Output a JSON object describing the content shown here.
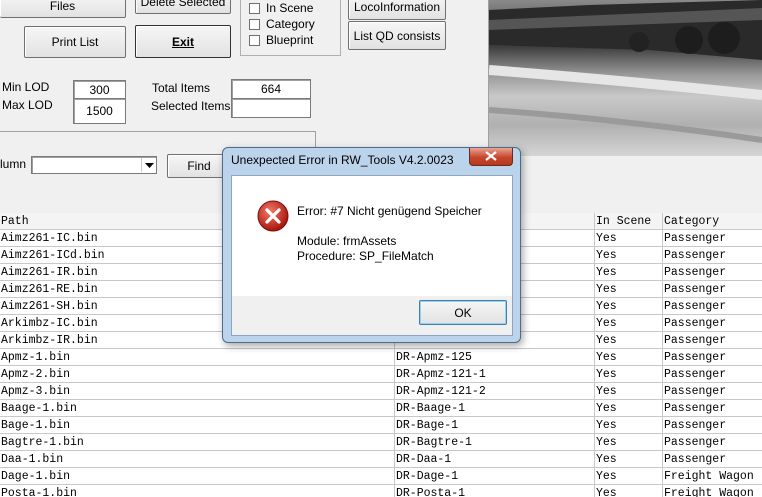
{
  "toolbar": {
    "files_label": "Files",
    "delete_selected_label": "Delete Selected",
    "print_list_label": "Print List",
    "exit_label": "Exit",
    "loco_info_label": "LocoInformation",
    "list_qd_label": "List QD consists"
  },
  "filters": {
    "in_scene": "In Scene",
    "category": "Category",
    "blueprint": "Blueprint"
  },
  "lod": {
    "min_label": "Min LOD",
    "min_value": "300",
    "max_label": "Max LOD",
    "max_value": "1500"
  },
  "totals": {
    "total_label": "Total Items",
    "total_value": "664",
    "selected_label": "Selected Items:",
    "selected_value": ""
  },
  "search": {
    "column_label": "lumn",
    "find_label": "Find"
  },
  "grid": {
    "headers": [
      "Path",
      "",
      "In Scene",
      "Category"
    ],
    "rows": [
      [
        "Aimz261-IC.bin",
        "",
        "Yes",
        "Passenger"
      ],
      [
        "Aimz261-ICd.bin",
        "",
        "Yes",
        "Passenger"
      ],
      [
        "Aimz261-IR.bin",
        "",
        "Yes",
        "Passenger"
      ],
      [
        "Aimz261-RE.bin",
        "",
        "Yes",
        "Passenger"
      ],
      [
        "Aimz261-SH.bin",
        "",
        "Yes",
        "Passenger"
      ],
      [
        "Arkimbz-IC.bin",
        "",
        "Yes",
        "Passenger"
      ],
      [
        "Arkimbz-IR.bin",
        "",
        "Yes",
        "Passenger"
      ],
      [
        "Apmz-1.bin",
        "DR-Apmz-125",
        "Yes",
        "Passenger"
      ],
      [
        "Apmz-2.bin",
        "DR-Apmz-121-1",
        "Yes",
        "Passenger"
      ],
      [
        "Apmz-3.bin",
        "DR-Apmz-121-2",
        "Yes",
        "Passenger"
      ],
      [
        "Baage-1.bin",
        "DR-Baage-1",
        "Yes",
        "Passenger"
      ],
      [
        "Bage-1.bin",
        "DR-Bage-1",
        "Yes",
        "Passenger"
      ],
      [
        "Bagtre-1.bin",
        "DR-Bagtre-1",
        "Yes",
        "Passenger"
      ],
      [
        "Daa-1.bin",
        "DR-Daa-1",
        "Yes",
        "Passenger"
      ],
      [
        "Dage-1.bin",
        "DR-Dage-1",
        "Yes",
        "Freight Wagon"
      ],
      [
        "Posta-1.bin",
        "DR-Posta-1",
        "Yes",
        "Freight Wagon"
      ]
    ]
  },
  "dialog": {
    "title": "Unexpected Error in RW_Tools V4.2.0023",
    "error_line": "Error: #7 Nicht genügend Speicher",
    "module_line": "Module: frmAssets",
    "procedure_line": "Procedure: SP_FileMatch",
    "ok_label": "OK",
    "icon": "error-icon"
  }
}
